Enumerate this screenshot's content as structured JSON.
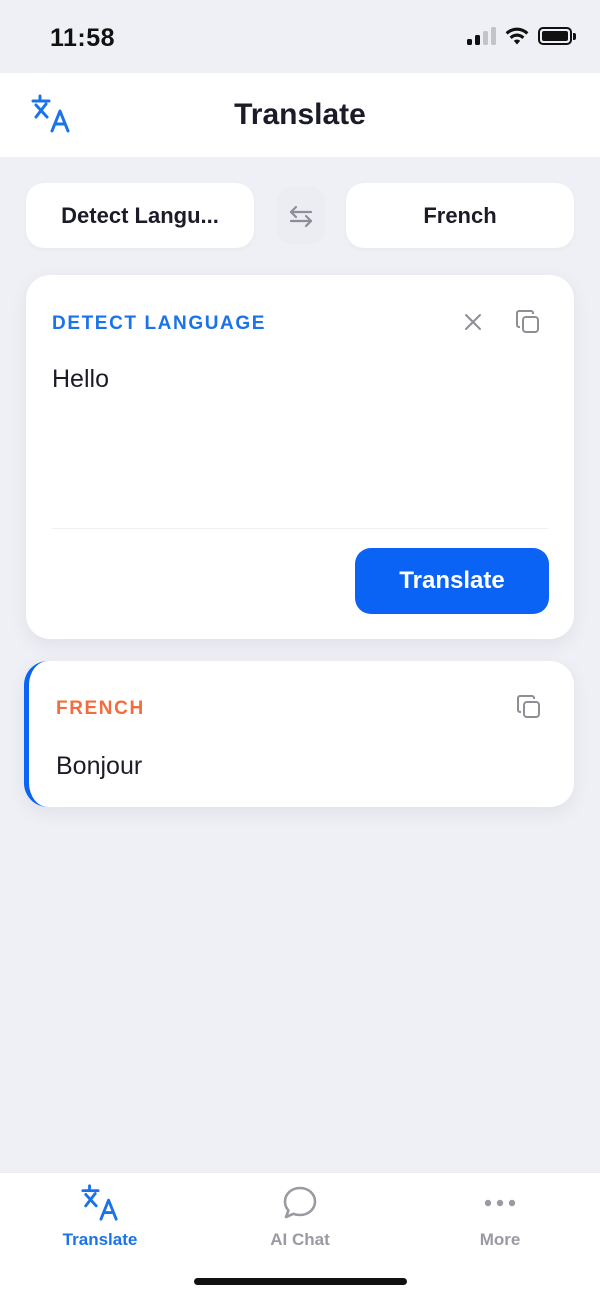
{
  "status_bar": {
    "time": "11:58"
  },
  "header": {
    "title": "Translate"
  },
  "language_selector": {
    "source": "Detect Langu...",
    "target": "French"
  },
  "input_card": {
    "label": "DETECT LANGUAGE",
    "text": "Hello",
    "translate_label": "Translate"
  },
  "output_card": {
    "label": "FRENCH",
    "text": "Bonjour"
  },
  "tab_bar": {
    "items": [
      {
        "label": "Translate",
        "icon": "translate-icon",
        "active": true
      },
      {
        "label": "AI Chat",
        "icon": "chat-bubble-icon",
        "active": false
      },
      {
        "label": "More",
        "icon": "more-dots-icon",
        "active": false
      }
    ]
  },
  "colors": {
    "accent": "#0a63f5",
    "label_blue": "#1a73e8",
    "label_orange": "#f26d3d",
    "background": "#eff0f5"
  }
}
